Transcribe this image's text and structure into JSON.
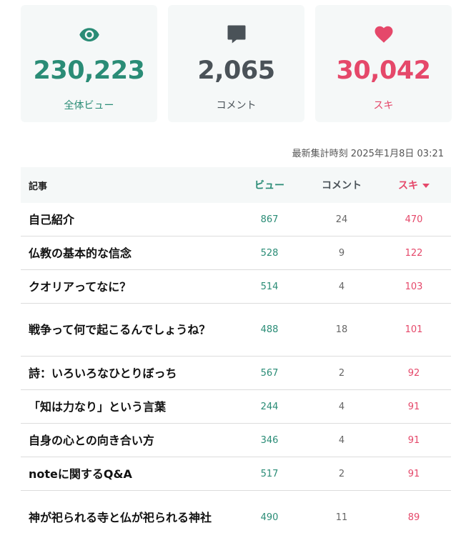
{
  "stats": {
    "views": {
      "value": "230,223",
      "label": "全体ビュー",
      "icon": "eye-icon"
    },
    "comments": {
      "value": "2,065",
      "label": "コメント",
      "icon": "comment-icon"
    },
    "likes": {
      "value": "30,042",
      "label": "スキ",
      "icon": "heart-icon"
    }
  },
  "timestamp": "最新集計時刻 2025年1月8日 03:21",
  "table": {
    "headers": {
      "title": "記事",
      "views": "ビュー",
      "comments": "コメント",
      "likes": "スキ"
    },
    "rows": [
      {
        "title": "自己紹介",
        "views": "867",
        "comments": "24",
        "likes": "470"
      },
      {
        "title": "仏教の基本的な信念",
        "views": "528",
        "comments": "9",
        "likes": "122"
      },
      {
        "title": "クオリアってなに？",
        "views": "514",
        "comments": "4",
        "likes": "103"
      },
      {
        "title": "戦争って何で起こるんでしょうね？",
        "views": "488",
        "comments": "18",
        "likes": "101"
      },
      {
        "title": "詩：いろいろなひとりぼっち",
        "views": "567",
        "comments": "2",
        "likes": "92"
      },
      {
        "title": "「知は力なり」という言葉",
        "views": "244",
        "comments": "4",
        "likes": "91"
      },
      {
        "title": "自身の心との向き合い方",
        "views": "346",
        "comments": "4",
        "likes": "91"
      },
      {
        "title": "noteに関するQ&A",
        "views": "517",
        "comments": "2",
        "likes": "91"
      },
      {
        "title": "神が祀られる寺と仏が祀られる神社",
        "views": "490",
        "comments": "11",
        "likes": "89"
      }
    ]
  },
  "colors": {
    "views": "#2a8c76",
    "comments": "#4a5258",
    "likes": "#e5486a"
  }
}
